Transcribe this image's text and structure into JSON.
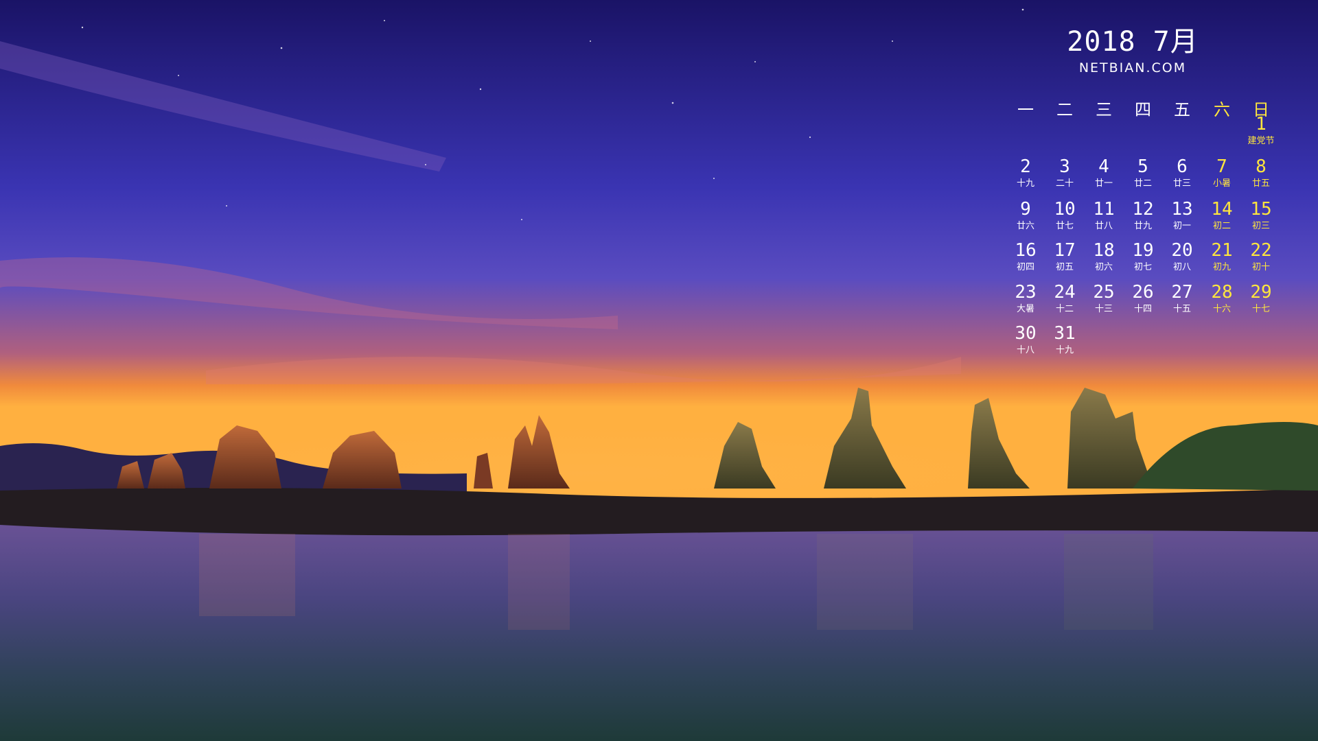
{
  "calendar": {
    "year_month": "2018 7月",
    "website": "NETBIAN.COM",
    "weekdays": [
      "一",
      "二",
      "三",
      "四",
      "五",
      "六",
      "日"
    ],
    "weekend_color": "#ffe63d",
    "text_color": "#ffffff",
    "days": [
      {
        "d": "1",
        "lunar": "建党节",
        "col": 6,
        "row": 0
      },
      {
        "d": "2",
        "lunar": "十九",
        "col": 0,
        "row": 1
      },
      {
        "d": "3",
        "lunar": "二十",
        "col": 1,
        "row": 1
      },
      {
        "d": "4",
        "lunar": "廿一",
        "col": 2,
        "row": 1
      },
      {
        "d": "5",
        "lunar": "廿二",
        "col": 3,
        "row": 1
      },
      {
        "d": "6",
        "lunar": "廿三",
        "col": 4,
        "row": 1
      },
      {
        "d": "7",
        "lunar": "小暑",
        "col": 5,
        "row": 1
      },
      {
        "d": "8",
        "lunar": "廿五",
        "col": 6,
        "row": 1
      },
      {
        "d": "9",
        "lunar": "廿六",
        "col": 0,
        "row": 2
      },
      {
        "d": "10",
        "lunar": "廿七",
        "col": 1,
        "row": 2
      },
      {
        "d": "11",
        "lunar": "廿八",
        "col": 2,
        "row": 2
      },
      {
        "d": "12",
        "lunar": "廿九",
        "col": 3,
        "row": 2
      },
      {
        "d": "13",
        "lunar": "初一",
        "col": 4,
        "row": 2
      },
      {
        "d": "14",
        "lunar": "初二",
        "col": 5,
        "row": 2
      },
      {
        "d": "15",
        "lunar": "初三",
        "col": 6,
        "row": 2
      },
      {
        "d": "16",
        "lunar": "初四",
        "col": 0,
        "row": 3
      },
      {
        "d": "17",
        "lunar": "初五",
        "col": 1,
        "row": 3
      },
      {
        "d": "18",
        "lunar": "初六",
        "col": 2,
        "row": 3
      },
      {
        "d": "19",
        "lunar": "初七",
        "col": 3,
        "row": 3
      },
      {
        "d": "20",
        "lunar": "初八",
        "col": 4,
        "row": 3
      },
      {
        "d": "21",
        "lunar": "初九",
        "col": 5,
        "row": 3
      },
      {
        "d": "22",
        "lunar": "初十",
        "col": 6,
        "row": 3
      },
      {
        "d": "23",
        "lunar": "大暑",
        "col": 0,
        "row": 4
      },
      {
        "d": "24",
        "lunar": "十二",
        "col": 1,
        "row": 4
      },
      {
        "d": "25",
        "lunar": "十三",
        "col": 2,
        "row": 4
      },
      {
        "d": "26",
        "lunar": "十四",
        "col": 3,
        "row": 4
      },
      {
        "d": "27",
        "lunar": "十五",
        "col": 4,
        "row": 4
      },
      {
        "d": "28",
        "lunar": "十六",
        "col": 5,
        "row": 4
      },
      {
        "d": "29",
        "lunar": "十七",
        "col": 6,
        "row": 4
      },
      {
        "d": "30",
        "lunar": "十八",
        "col": 0,
        "row": 5
      },
      {
        "d": "31",
        "lunar": "十九",
        "col": 1,
        "row": 5
      }
    ]
  },
  "scene": {
    "description_icon": "coastal-rocks-night-photo",
    "sky_colors": [
      "#1c1470",
      "#3a36b8",
      "#6a4fc0",
      "#c2607a",
      "#f08a40"
    ],
    "water_colors": [
      "#5b4a8a",
      "#3a3d6a",
      "#223a40"
    ]
  }
}
